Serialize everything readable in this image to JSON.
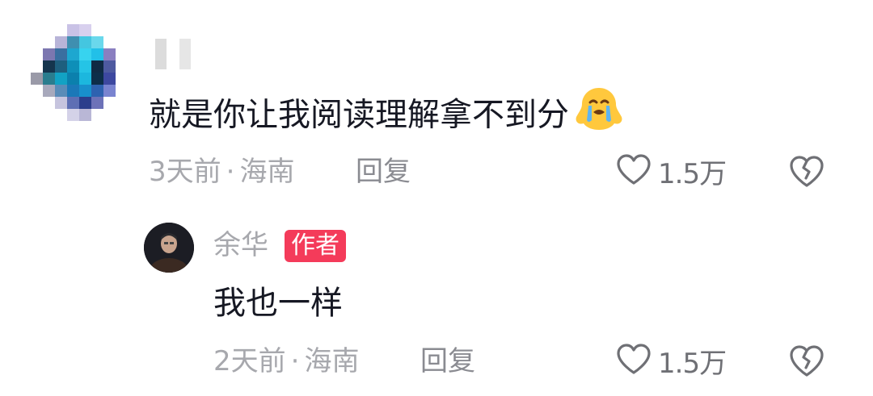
{
  "comments": [
    {
      "text": "就是你让我阅读理解拿不到分",
      "emoji": "crying-face-emoji",
      "time": "3天前",
      "separator": "·",
      "location": "海南",
      "reply_label": "回复",
      "likes": "1.5万"
    }
  ],
  "reply": {
    "author": "余华",
    "author_badge": "作者",
    "text": "我也一样",
    "time": "2天前",
    "separator": "·",
    "location": "海南",
    "reply_label": "回复",
    "likes": "1.5万"
  },
  "colors": {
    "text_primary": "#161823",
    "text_secondary": "#a7a8ad",
    "badge": "#f43b5a"
  }
}
